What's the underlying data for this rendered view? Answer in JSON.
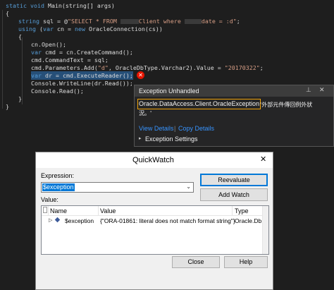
{
  "code": {
    "l1_kw": "static void",
    "l1_rest": " Main(string[] args)",
    "l2": "{",
    "l3_kw": "string",
    "l3_a": " sql = @",
    "l3_str_a": "\"SELECT * FROM ",
    "l3_str_b": "Client where ",
    "l3_str_c": "date = :d\"",
    "l3_end": ";",
    "l4_kw": "using",
    "l4_a": " (",
    "l4_kw2": "var",
    "l4_b": " cn = ",
    "l4_kw3": "new",
    "l4_c": " OracleConnection(cs))",
    "l5": "{",
    "l6": "cn.Open();",
    "l7_kw": "var",
    "l7_rest": " cmd = cn.CreateCommand();",
    "l8": "cmd.CommandText = sql;",
    "l9_a": "cmd.Parameters.Add(",
    "l9_str": "\"d\"",
    "l9_b": ", OracleDbType.Varchar2).Value = ",
    "l9_str2": "\"20170322\"",
    "l9_c": ";",
    "l10_kw": "var",
    "l10_rest": " dr = cmd.ExecuteReader();",
    "l11": "Console.WriteLine(dr.Read());",
    "l12": "Console.Read();",
    "l13": "}",
    "l14": "}"
  },
  "exception": {
    "title": "Exception Unhandled",
    "type": "Oracle.DataAccess.Client.OracleException",
    "msg1": "'外部元件傳回例外狀",
    "msg2": "況。'",
    "view_details": "View Details",
    "sep": "|",
    "copy_details": "Copy Details",
    "settings": "Exception Settings"
  },
  "quickwatch": {
    "title": "QuickWatch",
    "expression_label": "Expression:",
    "expression_value": "$exception",
    "value_label": "Value:",
    "col_name": "Name",
    "col_value": "Value",
    "col_type": "Type",
    "row_name": "$exception",
    "row_value": "{\"ORA-01861: literal does not match format string\"}",
    "row_type": "Oracle.Db",
    "reevaluate": "Reevaluate",
    "add_watch": "Add Watch",
    "close": "Close",
    "help": "Help"
  },
  "colors": {
    "editor_bg": "#1e1e1e",
    "keyword": "#569cd6",
    "string": "#d69d85",
    "highlight_border": "#f0a30a",
    "link": "#3794ff"
  }
}
